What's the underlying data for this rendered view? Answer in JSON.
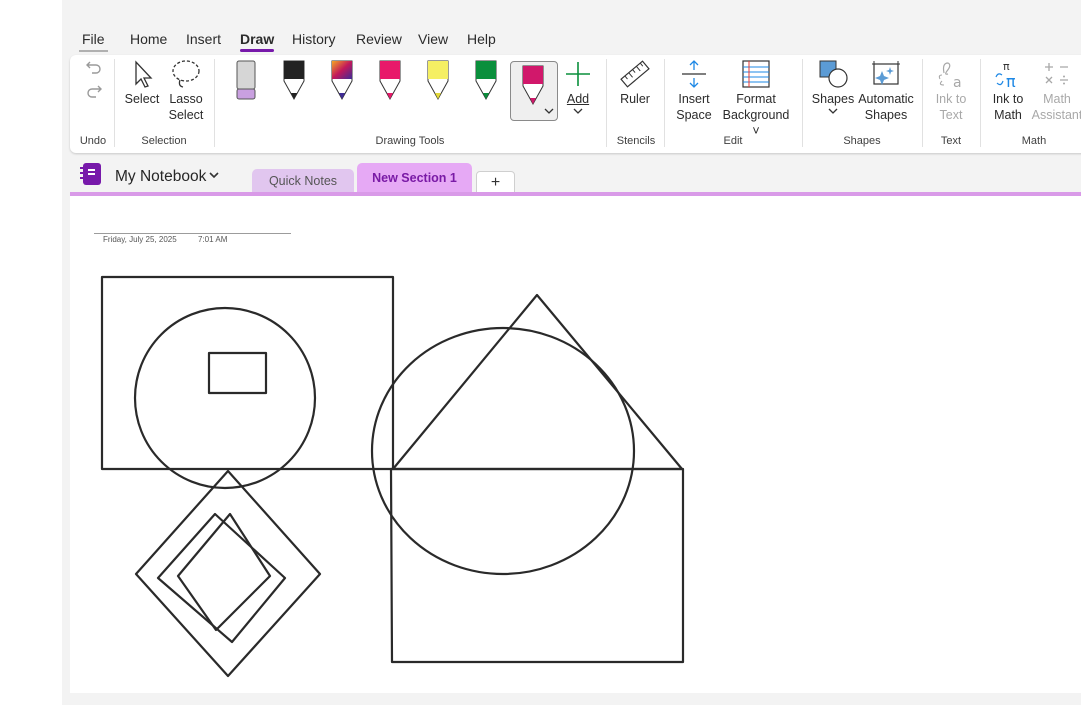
{
  "menu": {
    "file": "File",
    "home": "Home",
    "insert": "Insert",
    "draw": "Draw",
    "history": "History",
    "review": "Review",
    "view": "View",
    "help": "Help"
  },
  "ribbon": {
    "undo_group": "Undo",
    "select": "Select",
    "lasso_line1": "Lasso",
    "lasso_line2": "Select",
    "selection_group": "Selection",
    "drawing_tools_group": "Drawing Tools",
    "add": "Add",
    "ruler": "Ruler",
    "stencils_group": "Stencils",
    "insert_space_line1": "Insert",
    "insert_space_line2": "Space",
    "format_bg_line1": "Format",
    "format_bg_line2": "Background",
    "edit_group": "Edit",
    "shapes": "Shapes",
    "auto_shapes_line1": "Automatic",
    "auto_shapes_line2": "Shapes",
    "shapes_group": "Shapes",
    "ink_to_text_line1": "Ink to",
    "ink_to_text_line2": "Text",
    "text_group": "Text",
    "ink_to_math_line1": "Ink to",
    "ink_to_math_line2": "Math",
    "math_assistant_line1": "Math",
    "math_assistant_line2": "Assistant",
    "math_group": "Math",
    "pens": [
      {
        "name": "eraser-pencil",
        "color": "#c9a0e0"
      },
      {
        "name": "black-pen",
        "color": "#222222"
      },
      {
        "name": "galaxy-pen",
        "color": "#6b3fa0"
      },
      {
        "name": "pink-pen",
        "color": "#e8196a"
      },
      {
        "name": "yellow-highlighter",
        "color": "#f5ef63"
      },
      {
        "name": "green-pen",
        "color": "#0a8f3c"
      },
      {
        "name": "magenta-pen-selected",
        "color": "#d1186b"
      }
    ]
  },
  "notebook": {
    "name": "My Notebook",
    "sections": [
      "Quick Notes",
      "New Section 1"
    ],
    "add_section": "+"
  },
  "page": {
    "date": "Friday, July 25, 2025",
    "time": "7:01 AM"
  },
  "colors": {
    "accent": "#7719aa",
    "section_active": "#e6a9f5",
    "section_inactive": "#e1c6ef",
    "ink": "#2a2a2a"
  }
}
